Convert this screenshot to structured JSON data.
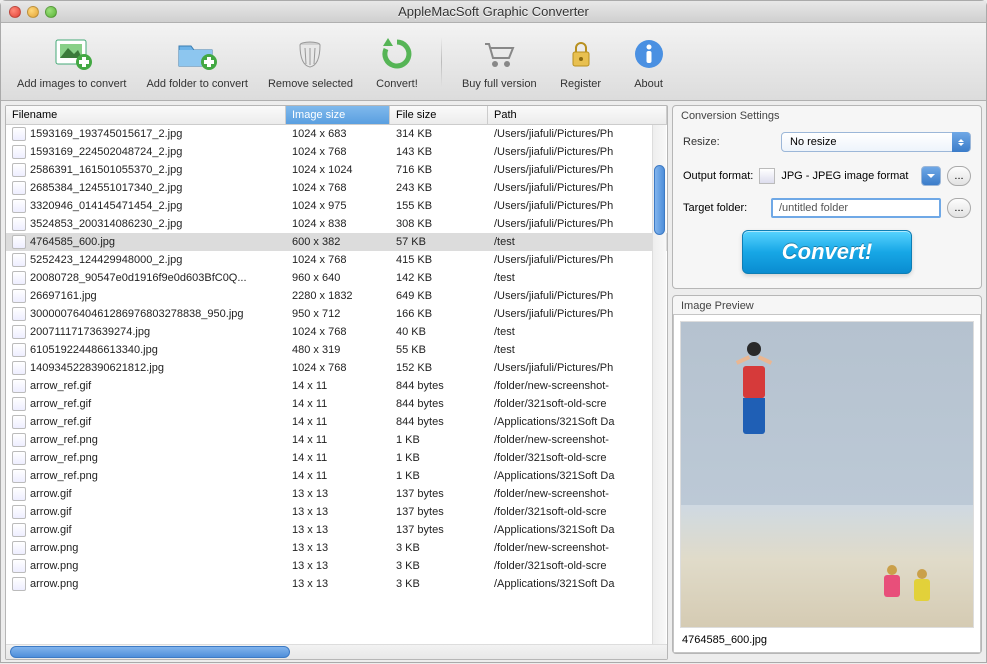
{
  "window": {
    "title": "AppleMacSoft Graphic Converter"
  },
  "toolbar": {
    "addImages": "Add images to convert",
    "addFolder": "Add folder to convert",
    "remove": "Remove selected",
    "convert": "Convert!",
    "buy": "Buy full version",
    "register": "Register",
    "about": "About"
  },
  "table": {
    "headers": {
      "filename": "Filename",
      "imageSize": "Image size",
      "fileSize": "File size",
      "path": "Path"
    },
    "selectedIndex": 6,
    "rows": [
      {
        "fn": "1593169_193745015617_2.jpg",
        "is": "1024 x 683",
        "fs": "314 KB",
        "pt": "/Users/jiafuli/Pictures/Ph"
      },
      {
        "fn": "1593169_224502048724_2.jpg",
        "is": "1024 x 768",
        "fs": "143 KB",
        "pt": "/Users/jiafuli/Pictures/Ph"
      },
      {
        "fn": "2586391_161501055370_2.jpg",
        "is": "1024 x 1024",
        "fs": "716 KB",
        "pt": "/Users/jiafuli/Pictures/Ph"
      },
      {
        "fn": "2685384_124551017340_2.jpg",
        "is": "1024 x 768",
        "fs": "243 KB",
        "pt": "/Users/jiafuli/Pictures/Ph"
      },
      {
        "fn": "3320946_014145471454_2.jpg",
        "is": "1024 x 975",
        "fs": "155 KB",
        "pt": "/Users/jiafuli/Pictures/Ph"
      },
      {
        "fn": "3524853_200314086230_2.jpg",
        "is": "1024 x 838",
        "fs": "308 KB",
        "pt": "/Users/jiafuli/Pictures/Ph"
      },
      {
        "fn": "4764585_600.jpg",
        "is": "600 x 382",
        "fs": "57 KB",
        "pt": "/test"
      },
      {
        "fn": "5252423_124429948000_2.jpg",
        "is": "1024 x 768",
        "fs": "415 KB",
        "pt": "/Users/jiafuli/Pictures/Ph"
      },
      {
        "fn": "20080728_90547e0d1916f9e0d603BfC0Q...",
        "is": "960 x 640",
        "fs": "142 KB",
        "pt": "/test"
      },
      {
        "fn": "26697161.jpg",
        "is": "2280 x 1832",
        "fs": "649 KB",
        "pt": "/Users/jiafuli/Pictures/Ph"
      },
      {
        "fn": "3000007640461286976803278838_950.jpg",
        "is": "950 x 712",
        "fs": "166 KB",
        "pt": "/Users/jiafuli/Pictures/Ph"
      },
      {
        "fn": "20071117173639274.jpg",
        "is": "1024 x 768",
        "fs": "40 KB",
        "pt": "/test"
      },
      {
        "fn": "610519224486613340.jpg",
        "is": "480 x 319",
        "fs": "55 KB",
        "pt": "/test"
      },
      {
        "fn": "1409345228390621812.jpg",
        "is": "1024 x 768",
        "fs": "152 KB",
        "pt": "/Users/jiafuli/Pictures/Ph"
      },
      {
        "fn": "arrow_ref.gif",
        "is": "14 x 11",
        "fs": "844 bytes",
        "pt": "/folder/new-screenshot-"
      },
      {
        "fn": "arrow_ref.gif",
        "is": "14 x 11",
        "fs": "844 bytes",
        "pt": "/folder/321soft-old-scre"
      },
      {
        "fn": "arrow_ref.gif",
        "is": "14 x 11",
        "fs": "844 bytes",
        "pt": "/Applications/321Soft Da"
      },
      {
        "fn": "arrow_ref.png",
        "is": "14 x 11",
        "fs": "1 KB",
        "pt": "/folder/new-screenshot-"
      },
      {
        "fn": "arrow_ref.png",
        "is": "14 x 11",
        "fs": "1 KB",
        "pt": "/folder/321soft-old-scre"
      },
      {
        "fn": "arrow_ref.png",
        "is": "14 x 11",
        "fs": "1 KB",
        "pt": "/Applications/321Soft Da"
      },
      {
        "fn": "arrow.gif",
        "is": "13 x 13",
        "fs": "137 bytes",
        "pt": "/folder/new-screenshot-"
      },
      {
        "fn": "arrow.gif",
        "is": "13 x 13",
        "fs": "137 bytes",
        "pt": "/folder/321soft-old-scre"
      },
      {
        "fn": "arrow.gif",
        "is": "13 x 13",
        "fs": "137 bytes",
        "pt": "/Applications/321Soft Da"
      },
      {
        "fn": "arrow.png",
        "is": "13 x 13",
        "fs": "3 KB",
        "pt": "/folder/new-screenshot-"
      },
      {
        "fn": "arrow.png",
        "is": "13 x 13",
        "fs": "3 KB",
        "pt": "/folder/321soft-old-scre"
      },
      {
        "fn": "arrow.png",
        "is": "13 x 13",
        "fs": "3 KB",
        "pt": "/Applications/321Soft Da"
      }
    ]
  },
  "settings": {
    "panelTitle": "Conversion Settings",
    "resizeLabel": "Resize:",
    "resizeValue": "No resize",
    "outputFormatLabel": "Output format:",
    "outputFormatValue": "JPG - JPEG image format",
    "targetFolderLabel": "Target folder:",
    "targetFolderValue": "/untitled folder",
    "convertButton": "Convert!",
    "ellipsis": "..."
  },
  "preview": {
    "panelTitle": "Image Preview",
    "filename": "4764585_600.jpg"
  }
}
